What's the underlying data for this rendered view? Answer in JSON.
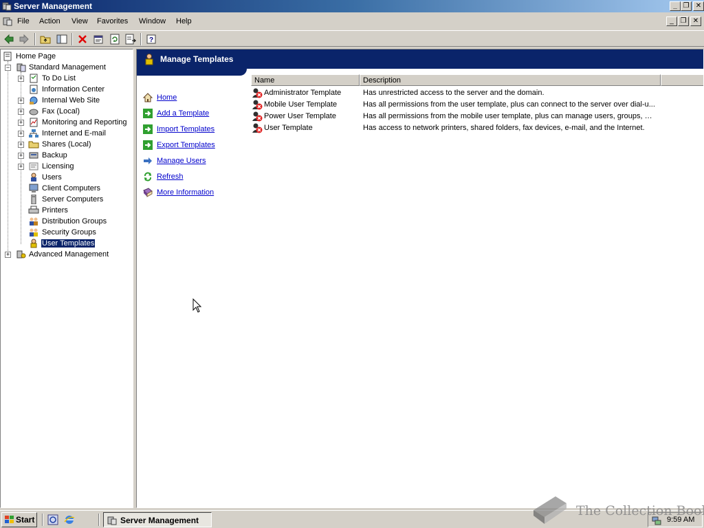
{
  "window": {
    "title": "Server Management"
  },
  "menu": [
    {
      "label": "File",
      "accel": "F"
    },
    {
      "label": "Action",
      "accel": "A"
    },
    {
      "label": "View",
      "accel": "V"
    },
    {
      "label": "Favorites",
      "accel": "o"
    },
    {
      "label": "Window",
      "accel": "W"
    },
    {
      "label": "Help",
      "accel": "H"
    }
  ],
  "toolbar": {
    "buttons": [
      "back-icon",
      "forward-icon",
      "up-folder-icon",
      "show-hide-tree-icon",
      "delete-icon",
      "properties-icon",
      "refresh-icon",
      "export-list-icon",
      "help-icon"
    ]
  },
  "tree": {
    "home": "Home Page",
    "standard": "Standard Management",
    "items": [
      {
        "label": "To Do List",
        "expandable": true
      },
      {
        "label": "Information Center",
        "expandable": false
      },
      {
        "label": "Internal Web Site",
        "expandable": true
      },
      {
        "label": "Fax (Local)",
        "expandable": true
      },
      {
        "label": "Monitoring and Reporting",
        "expandable": true
      },
      {
        "label": "Internet and E-mail",
        "expandable": true
      },
      {
        "label": "Shares (Local)",
        "expandable": true
      },
      {
        "label": "Backup",
        "expandable": true
      },
      {
        "label": "Licensing",
        "expandable": true
      },
      {
        "label": "Users",
        "expandable": false
      },
      {
        "label": "Client Computers",
        "expandable": false
      },
      {
        "label": "Server Computers",
        "expandable": false
      },
      {
        "label": "Printers",
        "expandable": false
      },
      {
        "label": "Distribution Groups",
        "expandable": false
      },
      {
        "label": "Security Groups",
        "expandable": false
      },
      {
        "label": "User Templates",
        "expandable": false,
        "selected": true
      }
    ],
    "advanced": "Advanced Management"
  },
  "content": {
    "header": "Manage Templates",
    "tasks": [
      {
        "label": "Home",
        "icon": "house-icon"
      },
      {
        "label": "Add a Template",
        "icon": "green-arrow-icon"
      },
      {
        "label": "Import Templates",
        "icon": "green-arrow-icon"
      },
      {
        "label": "Export Templates",
        "icon": "green-arrow-icon"
      },
      {
        "label": "Manage Users",
        "icon": "blue-arrow-icon"
      },
      {
        "label": "Refresh",
        "icon": "refresh-icon"
      },
      {
        "label": "More Information",
        "icon": "book-icon"
      }
    ],
    "columns": {
      "name": "Name",
      "description": "Description"
    },
    "rows": [
      {
        "name": "Administrator Template",
        "description": "Has unrestricted access to the server and the domain."
      },
      {
        "name": "Mobile User Template",
        "description": "Has all permissions from the user template, plus can connect to the server over dial-u..."
      },
      {
        "name": "Power User Template",
        "description": "Has all permissions from the mobile user template, plus can manage users, groups, pri..."
      },
      {
        "name": "User Template",
        "description": "Has access to network printers, shared folders, fax devices, e-mail, and the Internet."
      }
    ]
  },
  "taskbar": {
    "start": "Start",
    "task": "Server Management",
    "clock": "9:59 AM"
  },
  "watermark": "The Collection Book",
  "colors": {
    "title_start": "#0a246a",
    "title_end": "#a6caf0",
    "header_band": "#0a246a",
    "link": "#0000cc",
    "selection": "#0a246a"
  }
}
